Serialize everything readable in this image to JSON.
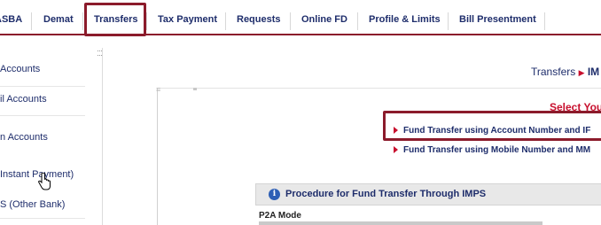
{
  "top_nav": {
    "items": [
      "ASBA",
      "Demat",
      "Transfers",
      "Tax Payment",
      "Requests",
      "Online FD",
      "Profile & Limits",
      "Bill Presentment"
    ],
    "active": "Transfers"
  },
  "sidebar": {
    "items": [
      "Accounts",
      "il Accounts",
      "n Accounts",
      "Instant Payment)",
      "S (Other Bank)"
    ]
  },
  "breadcrumb": {
    "section": "Transfers",
    "current": "IM"
  },
  "main": {
    "select_title": "Select You",
    "links": [
      "Fund Transfer using Account Number and IF",
      "Fund Transfer using Mobile Number and MM"
    ],
    "procedure": {
      "title": "Procedure for Fund Transfer Through IMPS",
      "p2a_heading": "P2A Mode"
    }
  },
  "colors": {
    "accent": "#8b1b2b",
    "link": "#1e2d6b",
    "red": "#c8102e",
    "info_icon": "#2e5fb5"
  }
}
